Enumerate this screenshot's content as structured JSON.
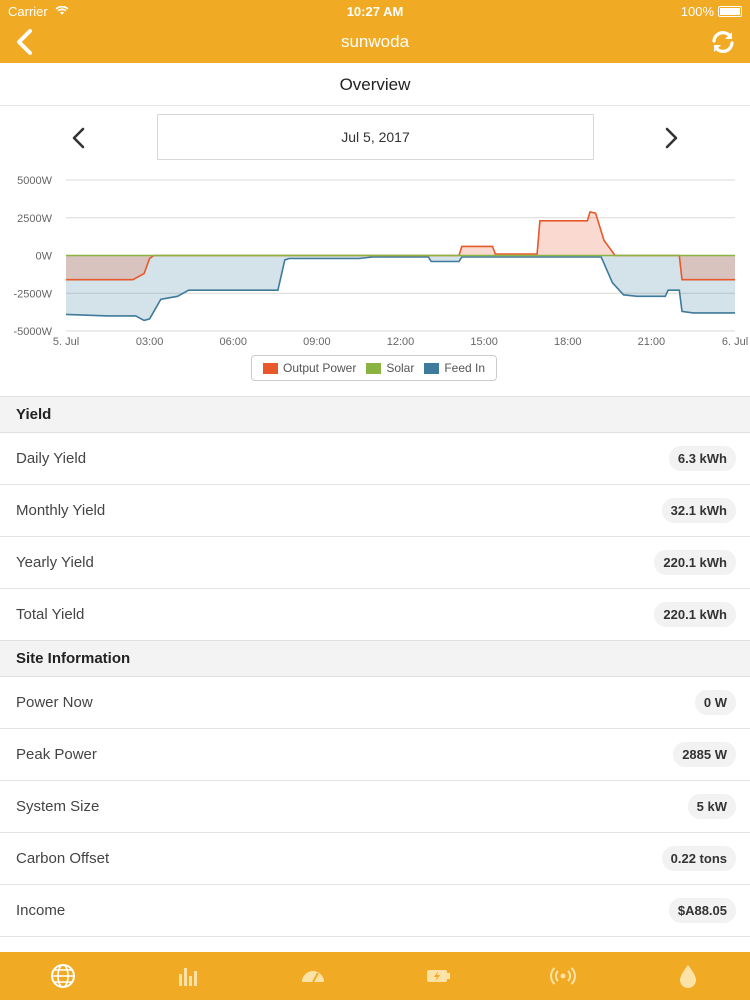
{
  "status_bar": {
    "carrier": "Carrier",
    "time": "10:27 AM",
    "battery": "100%"
  },
  "nav": {
    "title": "sunwoda"
  },
  "overview": {
    "title": "Overview"
  },
  "date": {
    "label": "Jul 5, 2017"
  },
  "chart_data": {
    "type": "area",
    "yticks": [
      "5000W",
      "2500W",
      "0W",
      "-2500W",
      "-5000W"
    ],
    "ylim": [
      -5000,
      5000
    ],
    "xticks": [
      "5. Jul",
      "03:00",
      "06:00",
      "09:00",
      "12:00",
      "15:00",
      "18:00",
      "21:00",
      "6. Jul"
    ],
    "xlim_hours": [
      0,
      24
    ],
    "grid": true,
    "legend_position": "bottom-center",
    "series": [
      {
        "name": "Output Power",
        "color": "#e8582a",
        "points": [
          [
            0,
            -1600
          ],
          [
            2.4,
            -1600
          ],
          [
            2.8,
            -1200
          ],
          [
            3.0,
            -200
          ],
          [
            3.15,
            0
          ],
          [
            14.1,
            0
          ],
          [
            14.2,
            600
          ],
          [
            15.3,
            600
          ],
          [
            15.4,
            100
          ],
          [
            16.9,
            100
          ],
          [
            17.0,
            2300
          ],
          [
            18.7,
            2300
          ],
          [
            18.8,
            2885
          ],
          [
            19.0,
            2800
          ],
          [
            19.3,
            1000
          ],
          [
            19.7,
            0
          ],
          [
            22.0,
            0
          ],
          [
            22.1,
            -1600
          ],
          [
            24,
            -1600
          ]
        ]
      },
      {
        "name": "Solar",
        "color": "#8bb341",
        "points": [
          [
            0,
            0
          ],
          [
            14.0,
            0
          ],
          [
            24,
            0
          ]
        ]
      },
      {
        "name": "Feed In",
        "color": "#3d7a9b",
        "points": [
          [
            0,
            -3900
          ],
          [
            1.5,
            -4000
          ],
          [
            2.5,
            -4000
          ],
          [
            2.8,
            -4300
          ],
          [
            3.0,
            -4200
          ],
          [
            3.4,
            -2900
          ],
          [
            3.7,
            -2800
          ],
          [
            4.0,
            -2700
          ],
          [
            4.4,
            -2300
          ],
          [
            5.5,
            -2300
          ],
          [
            6.5,
            -2300
          ],
          [
            7.3,
            -2300
          ],
          [
            7.6,
            -2300
          ],
          [
            7.85,
            -300
          ],
          [
            8.0,
            -200
          ],
          [
            9.0,
            -200
          ],
          [
            10.5,
            -200
          ],
          [
            11.0,
            -100
          ],
          [
            12.5,
            -100
          ],
          [
            13.0,
            -100
          ],
          [
            13.1,
            -400
          ],
          [
            14.1,
            -400
          ],
          [
            14.2,
            -100
          ],
          [
            19.0,
            -100
          ],
          [
            19.2,
            -100
          ],
          [
            19.6,
            -1800
          ],
          [
            20.0,
            -2600
          ],
          [
            20.5,
            -2700
          ],
          [
            21.5,
            -2700
          ],
          [
            21.6,
            -2300
          ],
          [
            22.0,
            -2300
          ],
          [
            22.1,
            -3700
          ],
          [
            22.5,
            -3800
          ],
          [
            23.3,
            -3800
          ],
          [
            24,
            -3800
          ]
        ]
      }
    ]
  },
  "yield_section": {
    "title": "Yield",
    "rows": [
      {
        "label": "Daily Yield",
        "value": "6.3 kWh"
      },
      {
        "label": "Monthly Yield",
        "value": "32.1 kWh"
      },
      {
        "label": "Yearly Yield",
        "value": "220.1 kWh"
      },
      {
        "label": "Total Yield",
        "value": "220.1 kWh"
      }
    ]
  },
  "site_section": {
    "title": "Site Information",
    "rows": [
      {
        "label": "Power Now",
        "value": "0 W"
      },
      {
        "label": "Peak Power",
        "value": "2885 W"
      },
      {
        "label": "System Size",
        "value": "5 kW"
      },
      {
        "label": "Carbon Offset",
        "value": "0.22 tons"
      },
      {
        "label": "Income",
        "value": "$A88.05"
      }
    ]
  },
  "colors": {
    "accent": "#f0aa23",
    "output": "#e8582a",
    "solar": "#8bb341",
    "feedin": "#3d7a9b"
  },
  "tabs": [
    {
      "icon": "globe-icon"
    },
    {
      "icon": "bar-chart-icon"
    },
    {
      "icon": "gauge-icon"
    },
    {
      "icon": "battery-charge-icon"
    },
    {
      "icon": "broadcast-icon"
    },
    {
      "icon": "water-drop-icon"
    }
  ]
}
